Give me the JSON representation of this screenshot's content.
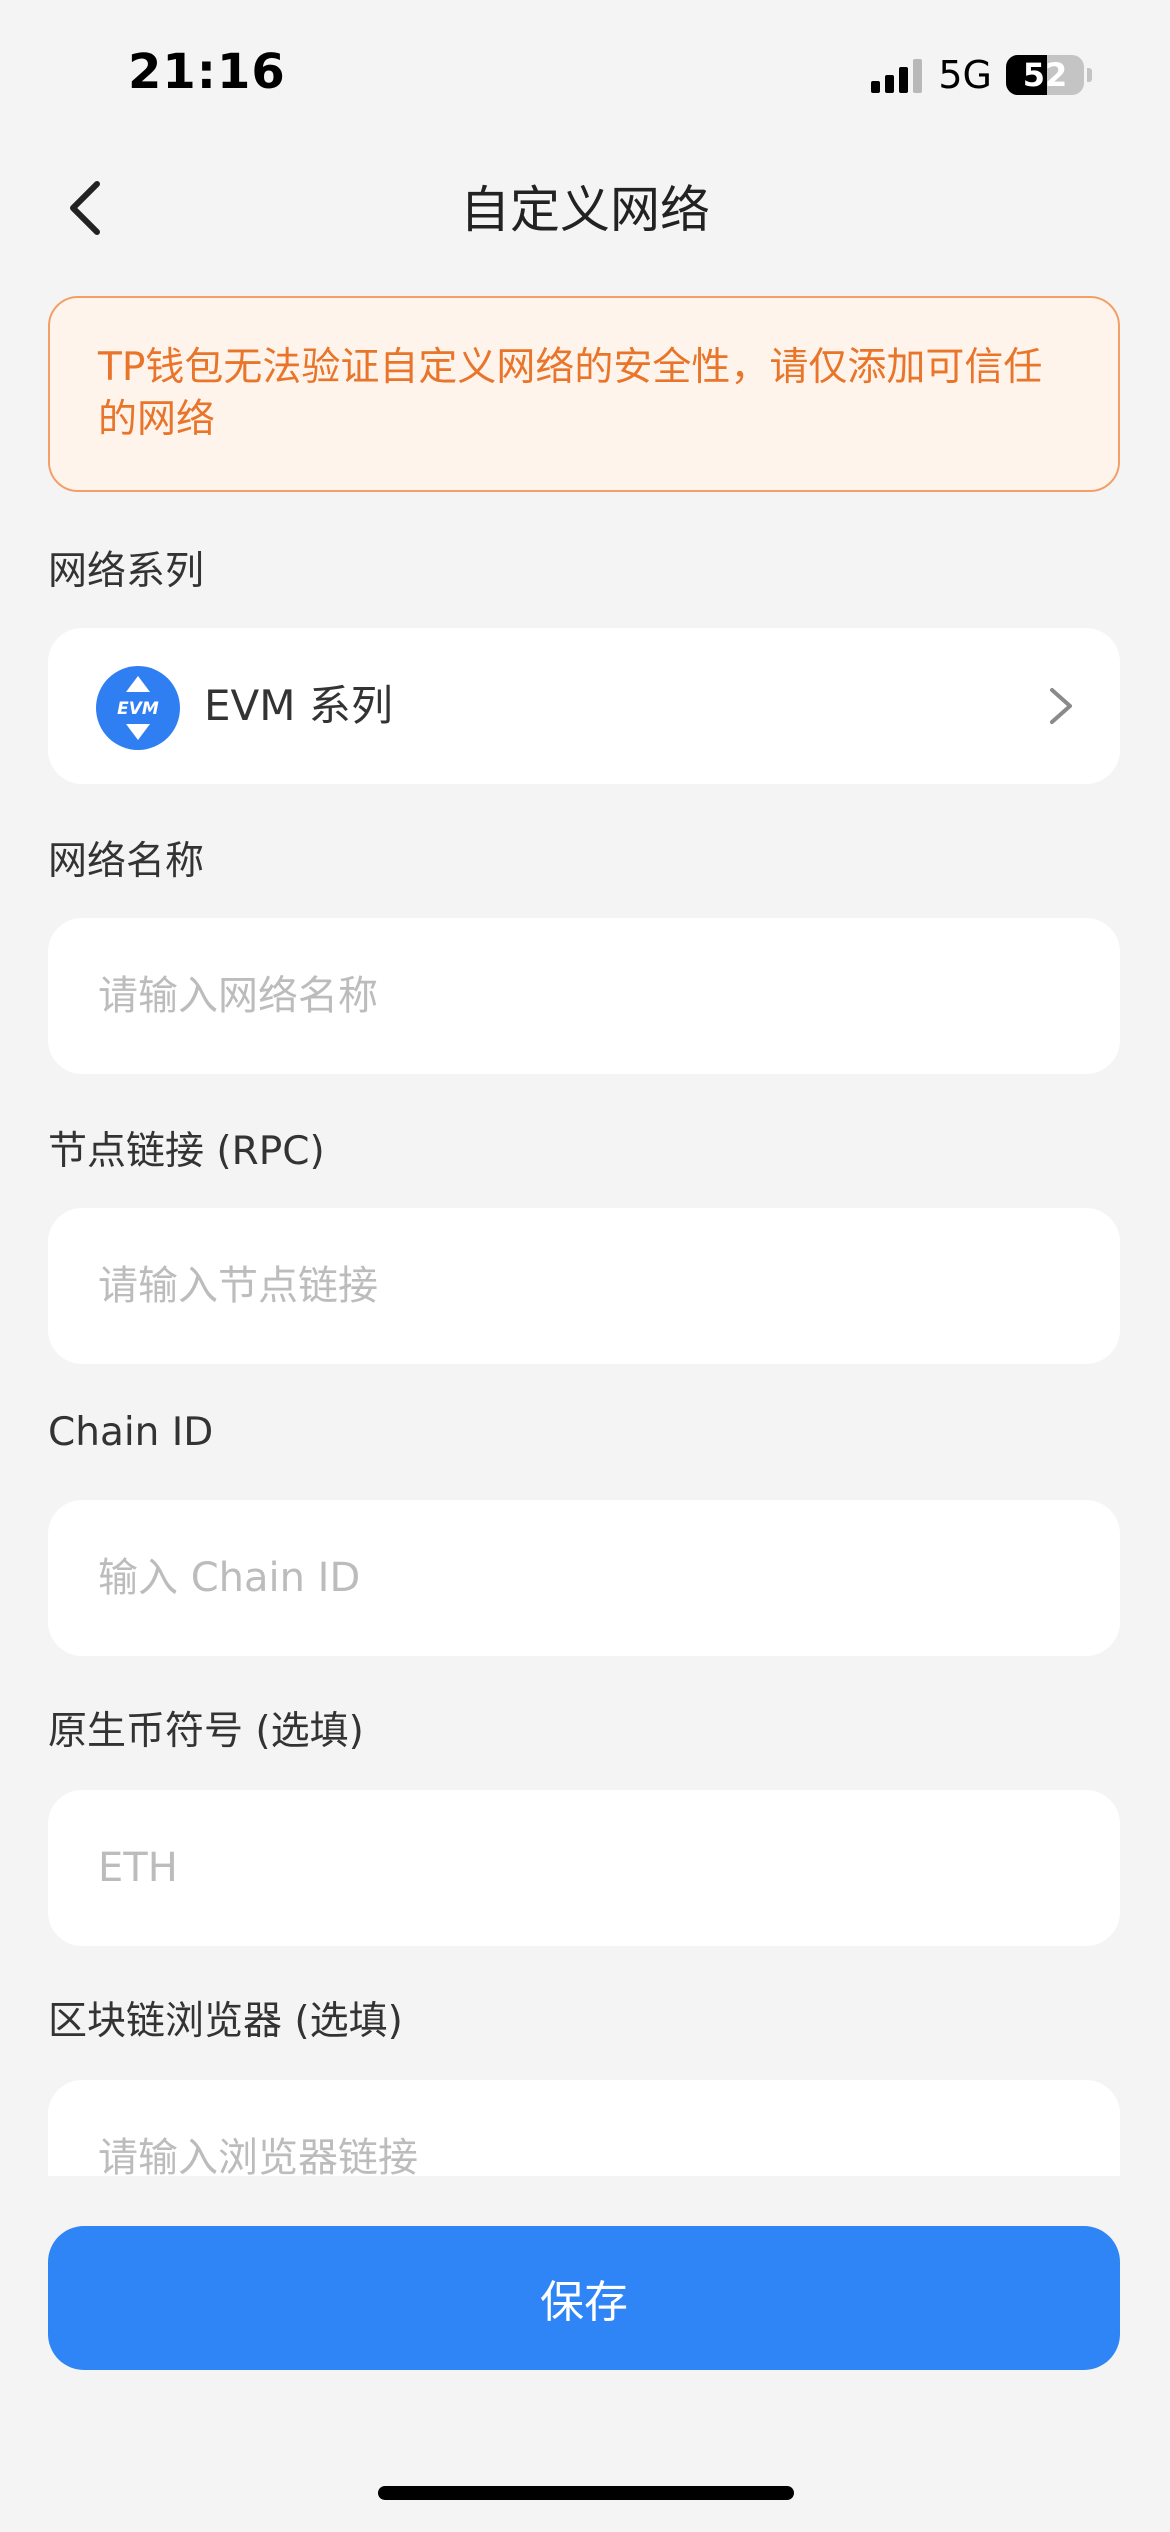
{
  "status_bar": {
    "time": "21:16",
    "network": "5G",
    "battery_level": "52",
    "battery_fraction": 0.52
  },
  "header": {
    "title": "自定义网络",
    "back_icon": "chevron-left-icon"
  },
  "warning": {
    "text": "TP钱包无法验证自定义网络的安全性，请仅添加可信任的网络",
    "color": "#e9752a"
  },
  "form": {
    "series": {
      "label": "网络系列",
      "badge_text": "EVM",
      "value": "EVM 系列"
    },
    "network_name": {
      "label": "网络名称",
      "placeholder": "请输入网络名称"
    },
    "rpc": {
      "label": "节点链接 (RPC)",
      "placeholder": "请输入节点链接"
    },
    "chain_id": {
      "label": "Chain ID",
      "placeholder": "输入 Chain ID"
    },
    "symbol": {
      "label": "原生币符号 (选填)",
      "placeholder": "ETH"
    },
    "explorer": {
      "label": "区块链浏览器 (选填)",
      "placeholder": "请输入浏览器链接"
    }
  },
  "actions": {
    "save_label": "保存",
    "accent": "#2f85f6"
  }
}
